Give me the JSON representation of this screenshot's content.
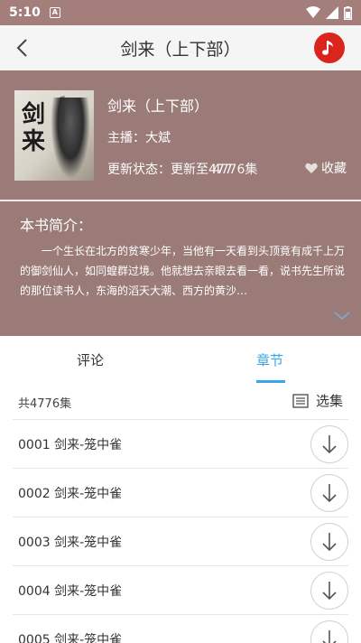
{
  "status_bar": {
    "time": "5:10",
    "notification_glyph": "A",
    "icons": [
      "wifi-icon",
      "signal-icon",
      "battery-icon"
    ]
  },
  "app_bar": {
    "title": "剑来（上下部）"
  },
  "book": {
    "title": "剑来（上下部）",
    "anchor": "主播：大斌",
    "update_status": "更新状态：更新至477",
    "update_overlay": "4776集",
    "favorite_label": "收藏",
    "cover_title": "剑来",
    "cover_side_text": "烽火戏诸侯"
  },
  "intro": {
    "label": "本书简介：",
    "text": "一个生长在北方的贫寒少年，当他有一天看到头顶竟有成千上万的御剑仙人，如同蝗群过境。他就想去亲眼去看一看，说书先生所说的那位读书人，东海的滔天大潮、西方的黄沙…"
  },
  "tabs": {
    "comment": "评论",
    "chapters": "章节"
  },
  "list": {
    "count": "共4776集",
    "select_label": "选集",
    "items": [
      {
        "label": "0001 剑来-笼中雀"
      },
      {
        "label": "0002 剑来-笼中雀"
      },
      {
        "label": "0003 剑来-笼中雀"
      },
      {
        "label": "0004 剑来-笼中雀"
      },
      {
        "label": "0005 剑来-笼中雀"
      }
    ]
  },
  "colors": {
    "hero": "#9a7b78",
    "accent": "#3aa6e8",
    "music": "#d9251c"
  }
}
